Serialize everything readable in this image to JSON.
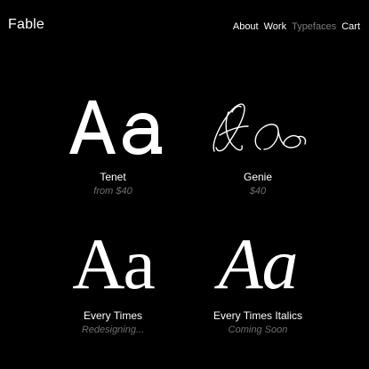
{
  "header": {
    "logo": "Fable",
    "nav": [
      {
        "label": "About",
        "active": false
      },
      {
        "label": "Work",
        "active": false
      },
      {
        "label": "Typefaces",
        "active": true
      },
      {
        "label": "Cart",
        "active": false
      }
    ]
  },
  "typefaces": [
    {
      "specimen": "Aa",
      "name": "Tenet",
      "subtitle": "from $40"
    },
    {
      "specimen": "Aa",
      "name": "Genie",
      "subtitle": "$40"
    },
    {
      "specimen": "Aa",
      "name": "Every Times",
      "subtitle": "Redesigning..."
    },
    {
      "specimen": "Aa",
      "name": "Every Times Italics",
      "subtitle": "Coming Soon"
    }
  ],
  "colors": {
    "background": "#000000",
    "text": "#ffffff",
    "muted": "#7c7c7c"
  }
}
